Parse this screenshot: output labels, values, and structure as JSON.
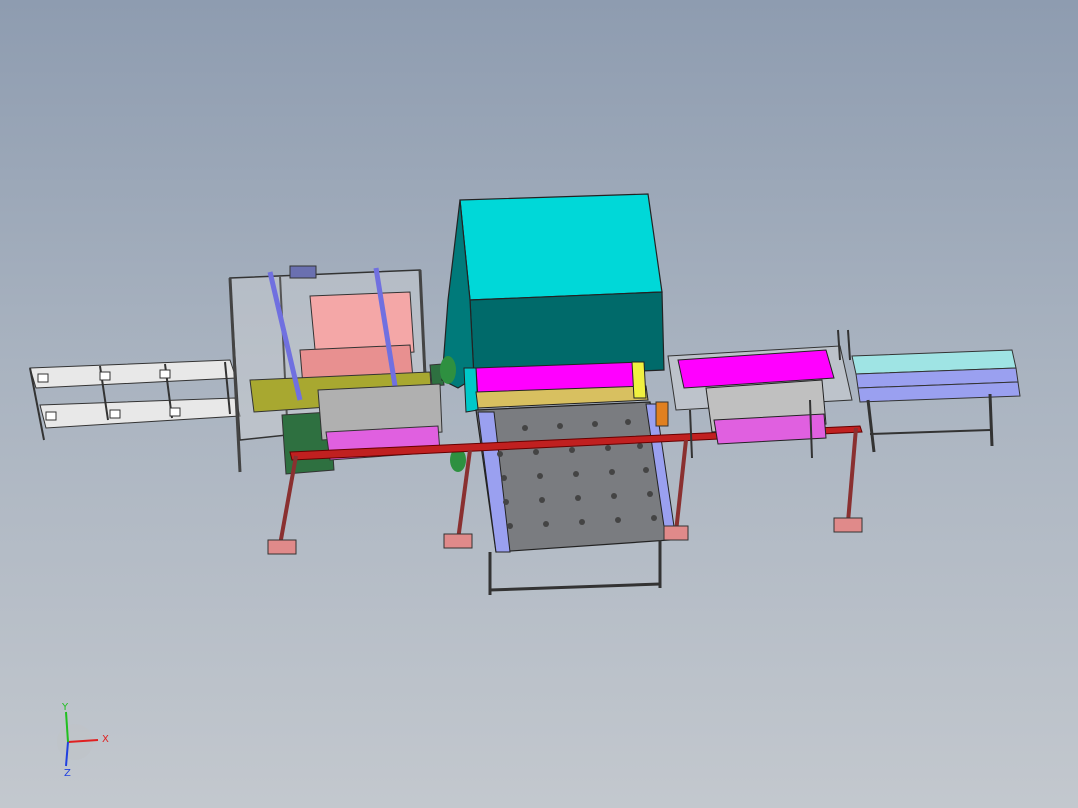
{
  "viewport": {
    "background_top": "#8e9cb0",
    "background_bottom": "#c3c8ce"
  },
  "triad": {
    "x_label": "X",
    "y_label": "Y",
    "z_label": "Z",
    "x_color": "#e02020",
    "y_color": "#20c020",
    "z_color": "#2040e0"
  },
  "colors": {
    "press_body": "#00e5e5",
    "press_platen": "#ff00ff",
    "pink_frame": "#f4a7a7",
    "olive_frame": "#a8a830",
    "magenta_trolley": "#e060e0",
    "lavender_conveyor": "#9aa0f0",
    "red_rail": "#c02020",
    "gray_table": "#7a7c80",
    "floor_pad": "#e08a8a"
  }
}
